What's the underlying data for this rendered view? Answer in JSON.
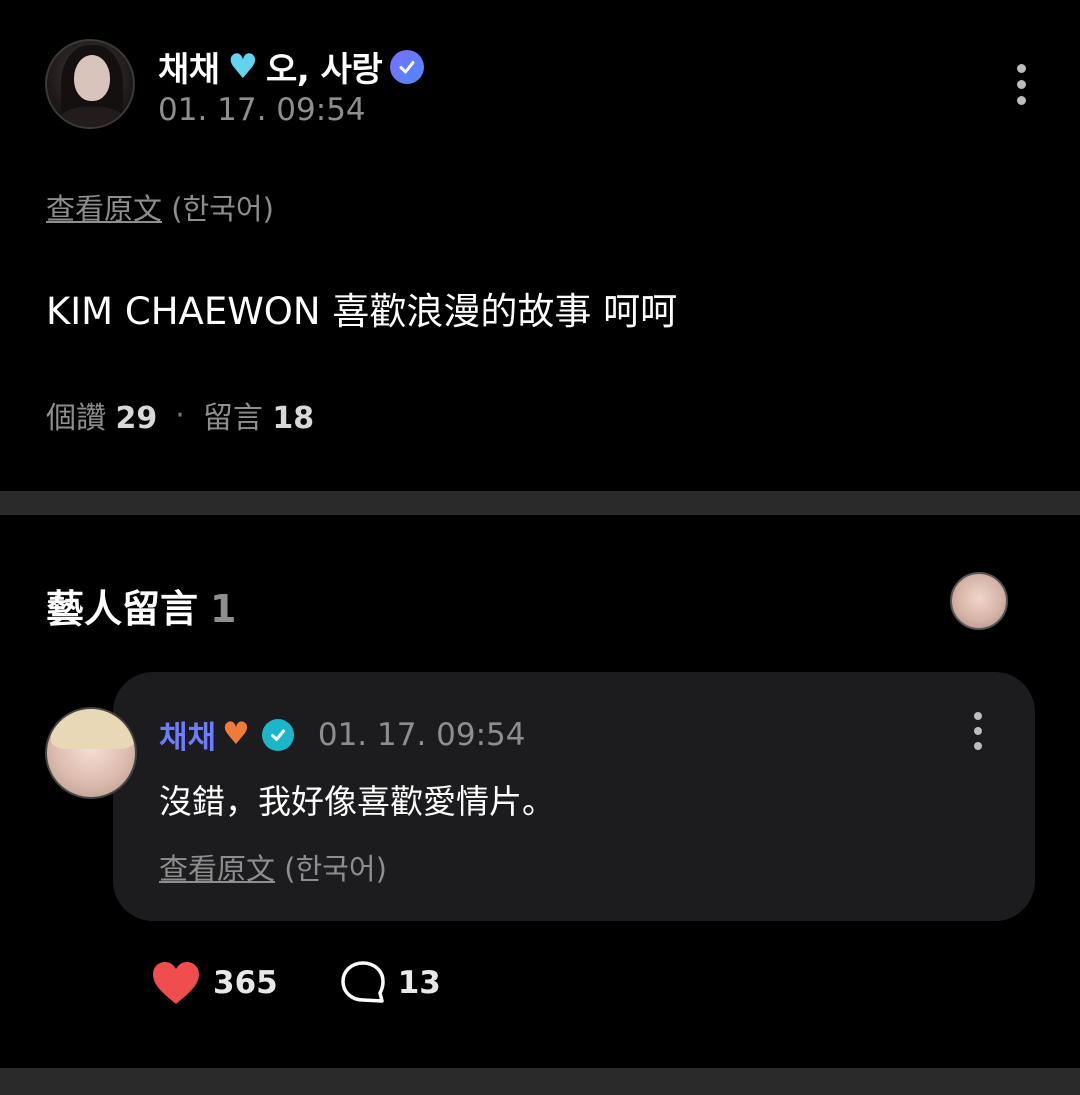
{
  "post": {
    "author": "채채",
    "author_suffix": "오, 사랑",
    "timestamp": "01. 17. 09:54",
    "translate_link": "查看原文",
    "translate_lang": "(한국어)",
    "body": "KIM CHAEWON 喜歡浪漫的故事 呵呵",
    "likes_label": "個讚",
    "likes_count": "29",
    "comments_label": "留言",
    "comments_count": "18"
  },
  "artist_comments": {
    "title": "藝人留言",
    "count": "1"
  },
  "comment": {
    "author": "채채",
    "timestamp": "01. 17. 09:54",
    "body": "沒錯，我好像喜歡愛情片。",
    "translate_link": "查看原文",
    "translate_lang": "(한국어)",
    "like_count": "365",
    "reply_count": "13"
  },
  "icons": {
    "post_heart": "cyan-heart-icon",
    "comment_heart": "orange-heart-icon",
    "verified": "verified-badge-icon",
    "more": "more-vertical-icon",
    "like": "heart-icon",
    "reply": "speech-bubble-icon"
  },
  "colors": {
    "background": "#000000",
    "card": "#1c1c1e",
    "comment_name": "#6c7dff",
    "like_heart": "#f04e4e",
    "muted_text": "#8e8e8e"
  }
}
